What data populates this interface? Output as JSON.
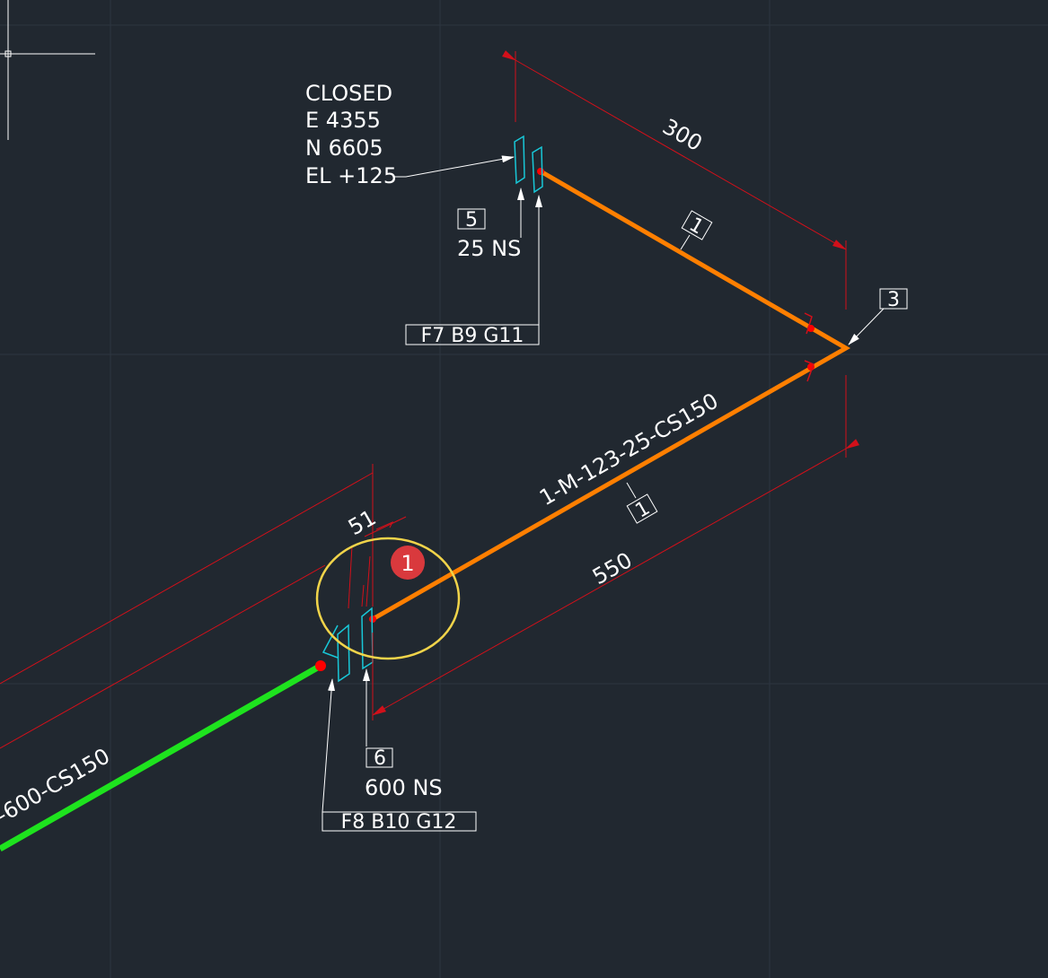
{
  "drawing": {
    "valve_annotation": {
      "lines": [
        "CLOSED",
        "E 4355",
        "N 6605",
        "EL +125"
      ]
    },
    "upper_item_number": "5",
    "upper_size": "25 NS",
    "upper_tag": "F7 B9 G11",
    "lower_item_number": "6",
    "lower_size": "600 NS",
    "lower_tag": "F8 B10 G12",
    "elbow_item_number": "3",
    "pipe_item_number_a": "1",
    "pipe_item_number_b": "1",
    "dimension_300": "300",
    "dimension_550": "550",
    "dimension_51": "51",
    "line_number_orange": "1-M-123-25-CS150",
    "line_number_green": "-600-CS150",
    "callout_marker": "1"
  },
  "colors": {
    "background": "#212830",
    "grid": "#2d3640",
    "orange_pipe": "#ff7f00",
    "green_pipe": "#1ee31e",
    "dimension": "#d2101a",
    "fitting": "#18c8d8",
    "text": "#ffffff",
    "callout_ring": "#f1d44a",
    "callout_badge": "#d9393d"
  },
  "icons": [
    "crosshair-cursor-icon",
    "arrowhead-icon"
  ]
}
